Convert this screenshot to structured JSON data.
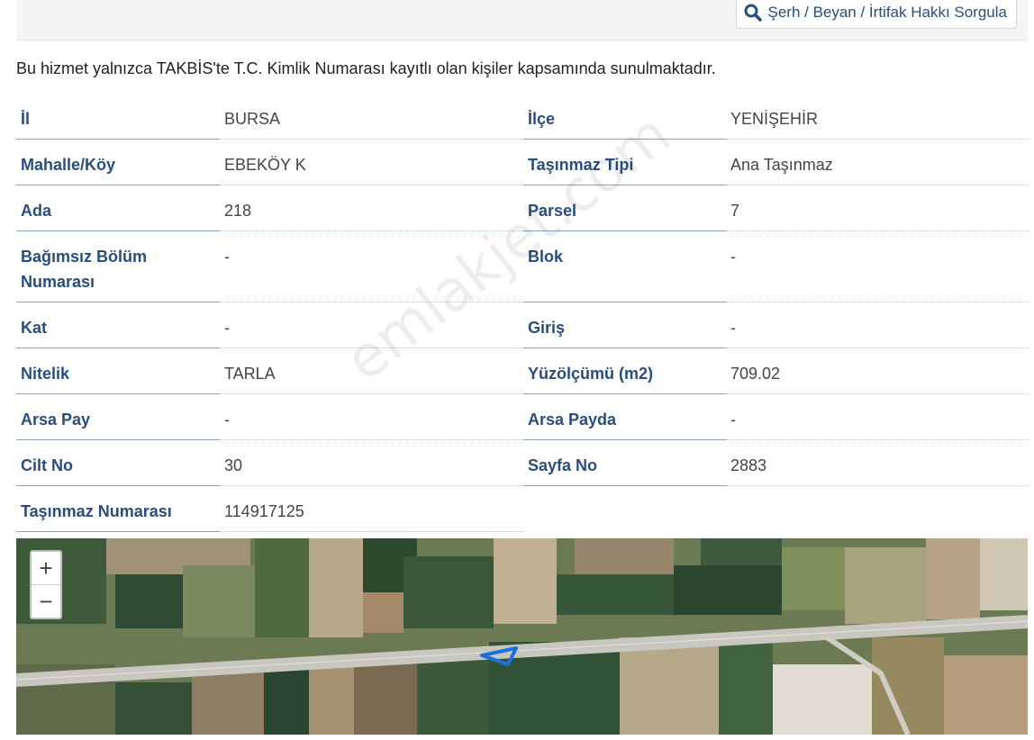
{
  "toolbar": {
    "query_button_label": "Şerh / Beyan / İrtifak Hakkı Sorgula",
    "query_button_icon": "search-icon"
  },
  "notice": "Bu hizmet yalnızca TAKBİS'te T.C. Kimlik Numarası kayıtlı olan kişiler kapsamında sunulmaktadır.",
  "fields": {
    "il": {
      "label": "İl",
      "value": "BURSA"
    },
    "ilce": {
      "label": "İlçe",
      "value": "YENİŞEHİR"
    },
    "mahalle": {
      "label": "Mahalle/Köy",
      "value": "EBEKÖY K"
    },
    "tasinmaz_tipi": {
      "label": "Taşınmaz Tipi",
      "value": "Ana Taşınmaz"
    },
    "ada": {
      "label": "Ada",
      "value": "218"
    },
    "parsel": {
      "label": "Parsel",
      "value": "7"
    },
    "bagimsiz_bolum_line1": {
      "label": "Bağımsız Bölüm",
      "value": "-"
    },
    "bagimsiz_bolum_line2": {
      "label": "Numarası"
    },
    "blok": {
      "label": "Blok",
      "value": "-"
    },
    "kat": {
      "label": "Kat",
      "value": "-"
    },
    "giris": {
      "label": "Giriş",
      "value": "-"
    },
    "nitelik": {
      "label": "Nitelik",
      "value": "TARLA"
    },
    "yuzolcumu": {
      "label": "Yüzölçümü (m2)",
      "value": "709.02"
    },
    "arsa_pay": {
      "label": "Arsa Pay",
      "value": "-"
    },
    "arsa_payda": {
      "label": "Arsa Payda",
      "value": "-"
    },
    "cilt_no": {
      "label": "Cilt No",
      "value": "30"
    },
    "sayfa_no": {
      "label": "Sayfa No",
      "value": "2883"
    },
    "tasinmaz_numarasi": {
      "label": "Taşınmaz Numarası",
      "value": "114917125"
    }
  },
  "map": {
    "zoom_in_label": "+",
    "zoom_out_label": "−",
    "parcel_color": "#1f6fe0"
  },
  "watermark": "emlakjet.com",
  "colors": {
    "label": "#2a4e7c",
    "value": "#444444"
  }
}
